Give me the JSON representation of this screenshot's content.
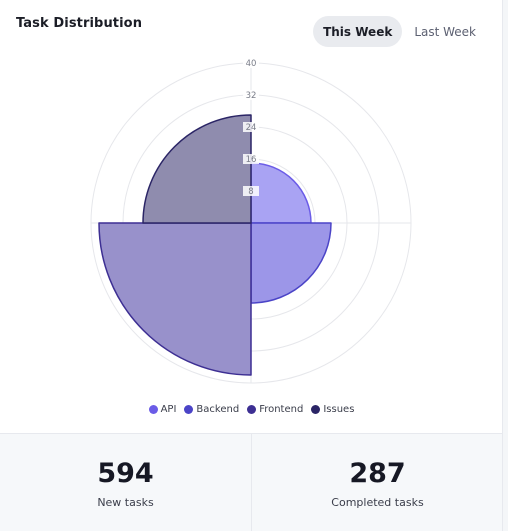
{
  "header": {
    "title": "Task Distribution",
    "tabs": [
      {
        "label": "This Week",
        "active": true
      },
      {
        "label": "Last Week",
        "active": false
      }
    ]
  },
  "chart_data": {
    "type": "polar-area",
    "categories": [
      "API",
      "Backend",
      "Frontend",
      "Issues"
    ],
    "values": [
      15,
      20,
      38,
      27
    ],
    "colors": [
      "#6b5ce7",
      "#4b44c7",
      "#3d2f93",
      "#2b2566"
    ],
    "fill_colors": [
      "#a9a3f3",
      "#9c96e8",
      "#9891cb",
      "#8f8cae"
    ],
    "r_ticks": [
      8,
      16,
      24,
      32,
      40
    ],
    "rlim": [
      0,
      40
    ],
    "grid": true,
    "legend": "bottom"
  },
  "stats": [
    {
      "value": "594",
      "label": "New tasks"
    },
    {
      "value": "287",
      "label": "Completed tasks"
    }
  ]
}
